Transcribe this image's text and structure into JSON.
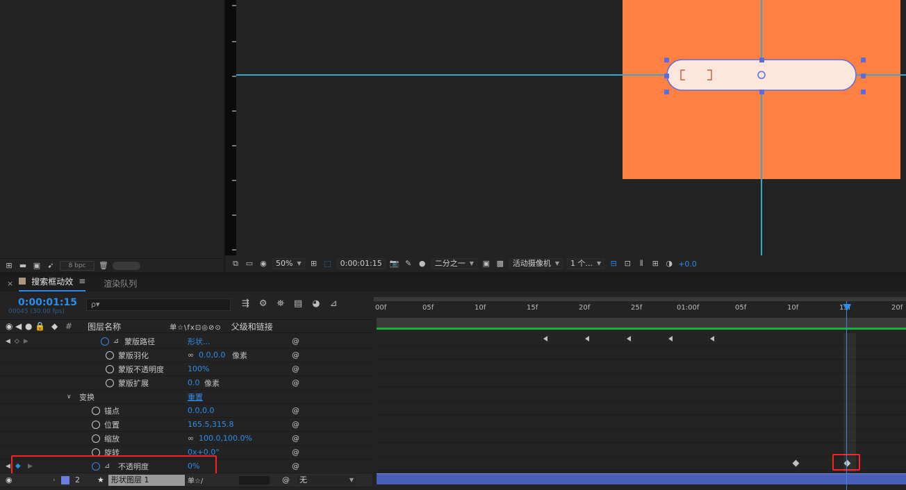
{
  "project_footer": {
    "bpc": "8 bpc"
  },
  "viewer": {
    "zoom": "50%",
    "timecode": "0:00:01:15",
    "resolution": "二分之一",
    "camera": "活动摄像机",
    "views": "1 个...",
    "exposure": "+0.0"
  },
  "timeline": {
    "tab_active": "搜索框动效",
    "tab_inactive": "渲染队列",
    "timecode": "0:00:01:15",
    "fps": "00045 (30.00 fps)",
    "search_placeholder": "ρ▾",
    "columns": {
      "num": "#",
      "layer_name": "图层名称",
      "switches": "单☆\\fx⊡◎⊘⊙",
      "parent": "父级和链接"
    },
    "rows": [
      {
        "name": "蒙版路径",
        "value": "形状..."
      },
      {
        "name": "蒙版羽化",
        "value": "0.0,0.0",
        "unit": "像素"
      },
      {
        "name": "蒙版不透明度",
        "value": "100%"
      },
      {
        "name": "蒙版扩展",
        "value": "0.0",
        "unit": "像素"
      },
      {
        "name": "变换",
        "value": "重置"
      },
      {
        "name": "锚点",
        "value": "0.0,0.0"
      },
      {
        "name": "位置",
        "value": "165.5,315.8"
      },
      {
        "name": "缩放",
        "value": "100.0,100.0%"
      },
      {
        "name": "旋转",
        "value": "0x+0.0°"
      },
      {
        "name": "不透明度",
        "value": "0%"
      }
    ],
    "layer": {
      "num": "2",
      "name": "形状图层 1",
      "parent": "无"
    },
    "ruler_ticks": [
      "00f",
      "05f",
      "10f",
      "15f",
      "20f",
      "25f",
      "01:00f",
      "05f",
      "10f",
      "15f",
      "20f"
    ]
  },
  "colors": {
    "accent": "#2d8ceb",
    "comp_bg": "#ff8040",
    "highlight": "#ff2020",
    "layer_bar": "#4a5fb8"
  }
}
